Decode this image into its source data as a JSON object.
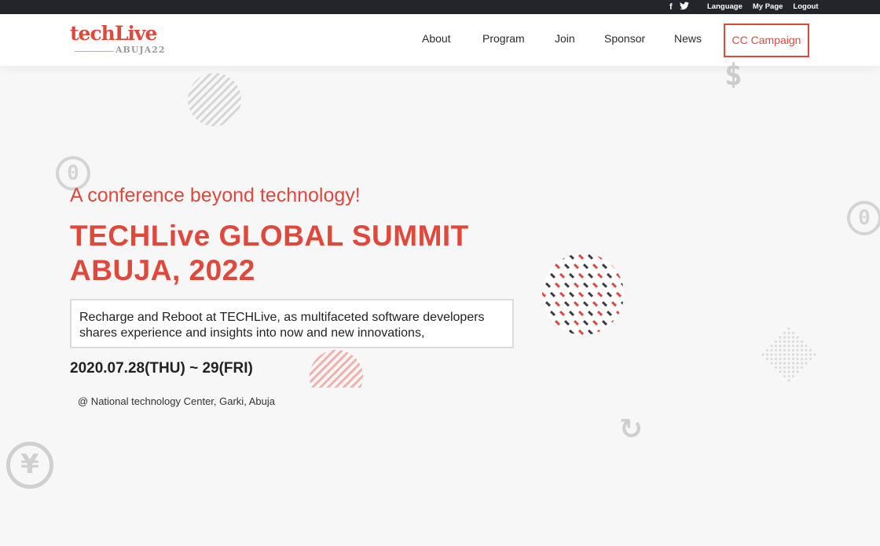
{
  "topbar": {
    "social_icons": [
      "facebook-icon",
      "twitter-icon"
    ],
    "facebook_glyph": "f",
    "twitter_glyph": "🐦",
    "links": [
      "Language",
      "My Page",
      "Logout"
    ]
  },
  "logo": {
    "brand": "techLive",
    "sub": "ABUJA22"
  },
  "nav": {
    "items": [
      "About",
      "Program",
      "Join",
      "Sponsor",
      "News"
    ],
    "cta": "CC Campaign"
  },
  "hero": {
    "subtitle": "A conference beyond technology!",
    "title_line1": "TECHLive GLOBAL SUMMIT",
    "title_line2": "ABUJA, 2022",
    "description": "Recharge and Reboot at TECHLive, as multifaceted software developers shares experience and insights into now and new innovations,",
    "dates": "2020.07.28(THU) ~ 29(FRI)",
    "venue": "@ National technology Center, Garki, Abuja"
  },
  "decorations": {
    "dollar_glyph": "$",
    "zero_glyph": "0",
    "yen_glyph": "¥",
    "refresh_glyph": "↻"
  },
  "colors": {
    "accent": "#e0483b",
    "topbar": "#23252b",
    "background": "#f7f7f7",
    "muted": "#cccccc",
    "dark_pattern": "#3a3d47"
  }
}
